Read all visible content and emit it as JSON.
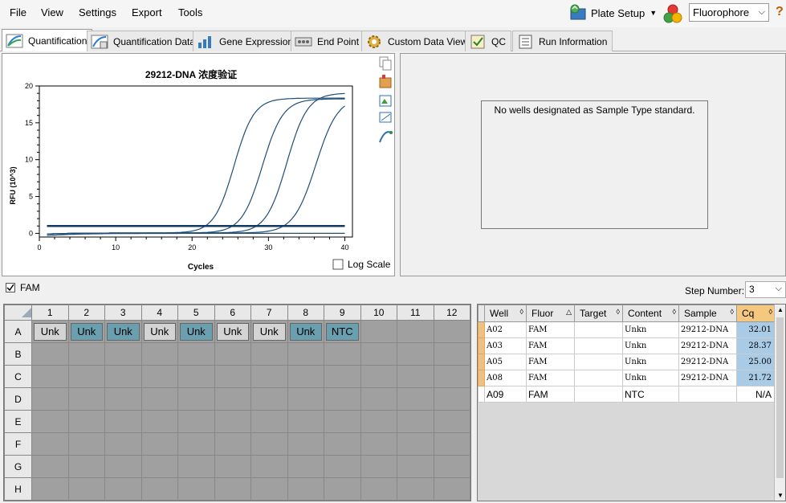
{
  "menu": {
    "file": "File",
    "view": "View",
    "settings": "Settings",
    "export": "Export",
    "tools": "Tools"
  },
  "toolbar": {
    "plate_setup": "Plate Setup",
    "fluor_select": "Fluorophore",
    "help": "?"
  },
  "tabs": [
    {
      "label": "Quantification",
      "icon": "quantification-icon"
    },
    {
      "label": "Quantification Data",
      "icon": "quantification-data-icon"
    },
    {
      "label": "Gene Expression",
      "icon": "gene-expression-icon"
    },
    {
      "label": "End Point",
      "icon": "end-point-icon"
    },
    {
      "label": "Custom Data View",
      "icon": "custom-data-view-icon"
    },
    {
      "label": "QC",
      "icon": "qc-icon"
    },
    {
      "label": "Run Information",
      "icon": "run-information-icon"
    }
  ],
  "chart_data": {
    "type": "line",
    "title": "29212-DNA 浓度验证",
    "xlabel": "Cycles",
    "ylabel": "RFU (10^3)",
    "xlim": [
      0,
      41
    ],
    "ylim": [
      -0.5,
      20
    ],
    "xticks": [
      0,
      10,
      20,
      30,
      40
    ],
    "yticks": [
      0,
      5,
      10,
      15,
      20
    ],
    "grid": true,
    "log_scale_label": "Log Scale",
    "log_scale": false,
    "threshold": 1.0,
    "series": [
      {
        "midpoint": 25.5,
        "plateau": 18.3,
        "slope": 1.3,
        "end_x": 40
      },
      {
        "midpoint": 29.2,
        "plateau": 18.2,
        "slope": 1.35,
        "end_x": 40
      },
      {
        "midpoint": 32.4,
        "plateau": 19.0,
        "slope": 1.35,
        "end_x": 40
      },
      {
        "midpoint": 36.2,
        "plateau": 18.5,
        "slope": 1.45,
        "end_x": 40
      }
    ]
  },
  "std_curve": {
    "message": "No wells designated as Sample Type standard."
  },
  "fam_filter": {
    "label": "FAM",
    "checked": true
  },
  "step_number": {
    "label": "Step Number:",
    "value": "3"
  },
  "plate": {
    "columns": [
      "1",
      "2",
      "3",
      "4",
      "5",
      "6",
      "7",
      "8",
      "9",
      "10",
      "11",
      "12"
    ],
    "rows": [
      "A",
      "B",
      "C",
      "D",
      "E",
      "F",
      "G",
      "H"
    ],
    "row_a": [
      {
        "label": "Unk",
        "style": "light"
      },
      {
        "label": "Unk",
        "style": "teal"
      },
      {
        "label": "Unk",
        "style": "teal"
      },
      {
        "label": "Unk",
        "style": "light"
      },
      {
        "label": "Unk",
        "style": "teal"
      },
      {
        "label": "Unk",
        "style": "light"
      },
      {
        "label": "Unk",
        "style": "light"
      },
      {
        "label": "Unk",
        "style": "teal"
      },
      {
        "label": "NTC",
        "style": "teal"
      }
    ]
  },
  "results": {
    "columns": [
      "Well",
      "Fluor",
      "Target",
      "Content",
      "Sample",
      "Cq"
    ],
    "rows": [
      {
        "well": "A02",
        "fluor": "FAM",
        "target": "",
        "content": "Unkn",
        "sample": "29212-DNA",
        "cq": "32.01",
        "selected": true
      },
      {
        "well": "A03",
        "fluor": "FAM",
        "target": "",
        "content": "Unkn",
        "sample": "29212-DNA",
        "cq": "28.37",
        "selected": true
      },
      {
        "well": "A05",
        "fluor": "FAM",
        "target": "",
        "content": "Unkn",
        "sample": "29212-DNA",
        "cq": "25.00",
        "selected": true
      },
      {
        "well": "A08",
        "fluor": "FAM",
        "target": "",
        "content": "Unkn",
        "sample": "29212-DNA",
        "cq": "21.72",
        "selected": true
      },
      {
        "well": "A09",
        "fluor": "FAM",
        "target": "",
        "content": "NTC",
        "sample": "",
        "cq": "N/A",
        "selected": false
      }
    ]
  },
  "colors": {
    "curve": "#1f4e79",
    "teal_well": "#6a9fb0",
    "cq_cell": "#a9cbe6",
    "selected_marker": "#f0c080"
  }
}
